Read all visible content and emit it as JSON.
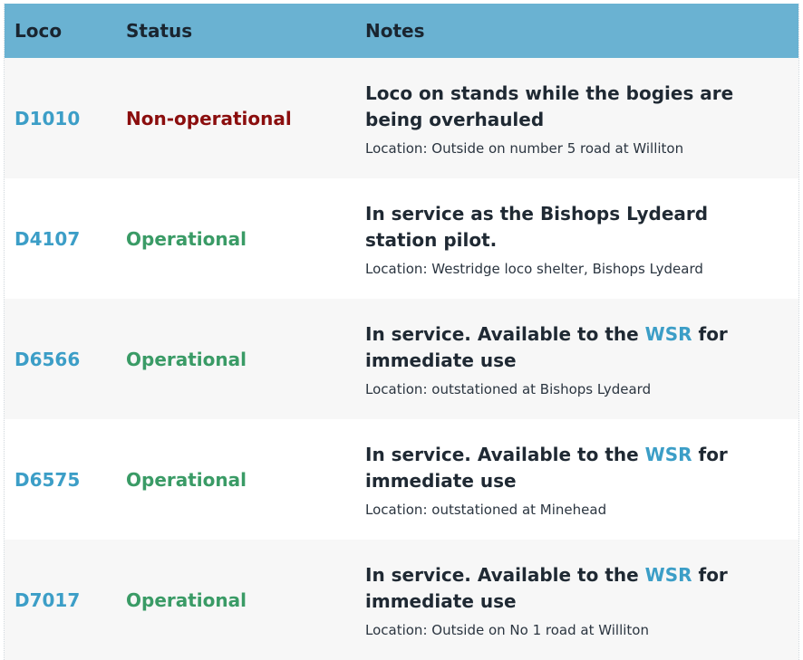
{
  "colors": {
    "header_bg": "#6ab2d2",
    "link": "#3c9ec7",
    "operational": "#3a9b66",
    "non_operational": "#8b0e0e",
    "row_alt": "#f7f7f7"
  },
  "header": {
    "loco": "Loco",
    "status": "Status",
    "notes": "Notes"
  },
  "rows": [
    {
      "loco": "D1010",
      "status": "Non-operational",
      "status_kind": "non_operational",
      "note_prefix": "Loco on stands while the bogies are being overhauled",
      "note_link": "",
      "note_suffix": "",
      "location": "Location: Outside on number 5 road at Williton"
    },
    {
      "loco": "D4107",
      "status": "Operational",
      "status_kind": "operational",
      "note_prefix": "In service as the Bishops Lydeard station pilot.",
      "note_link": "",
      "note_suffix": "",
      "location": "Location: Westridge loco shelter, Bishops Lydeard"
    },
    {
      "loco": "D6566",
      "status": "Operational",
      "status_kind": "operational",
      "note_prefix": "In service. Available to the ",
      "note_link": "WSR",
      "note_suffix": " for immediate use",
      "location": "Location: outstationed at Bishops Lydeard"
    },
    {
      "loco": "D6575",
      "status": "Operational",
      "status_kind": "operational",
      "note_prefix": "In service. Available to the ",
      "note_link": "WSR",
      "note_suffix": " for immediate use",
      "location": "Location: outstationed at Minehead"
    },
    {
      "loco": "D7017",
      "status": "Operational",
      "status_kind": "operational",
      "note_prefix": "In service. Available to the ",
      "note_link": "WSR",
      "note_suffix": " for immediate use",
      "location": "Location: Outside on No 1 road at Williton"
    }
  ]
}
